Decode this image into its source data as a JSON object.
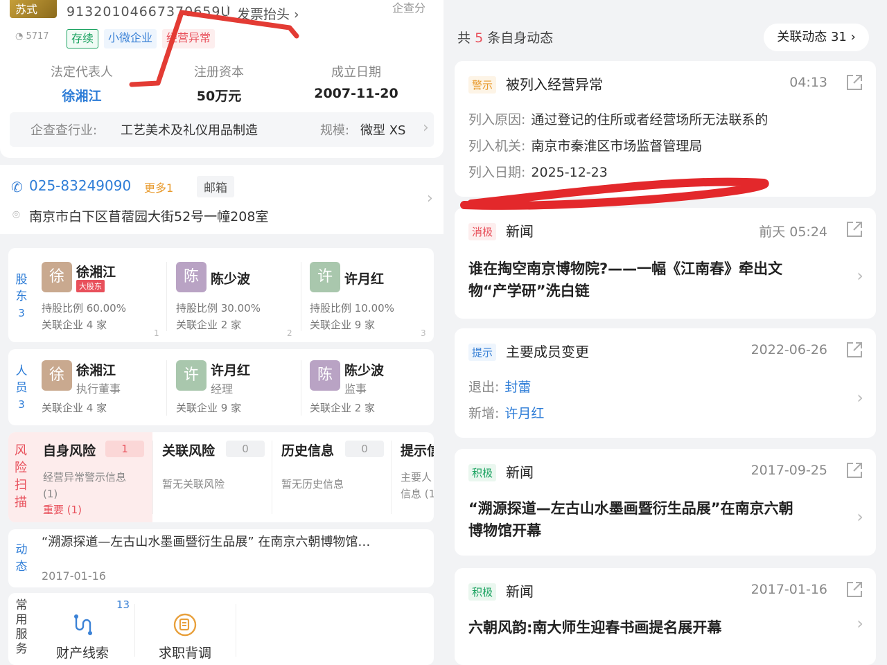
{
  "left": {
    "header": {
      "logo_text": "苏式",
      "credit_code": "91320104667370659U",
      "invoice_label": "发票抬头",
      "qcc_score": "企查分",
      "views": "5717"
    },
    "tags": [
      "存续",
      "小微企业",
      "经营异常"
    ],
    "info": [
      {
        "label": "法定代表人",
        "value": "徐湘江"
      },
      {
        "label": "注册资本",
        "value": "50万元"
      },
      {
        "label": "成立日期",
        "value": "2007-11-20"
      }
    ],
    "industry": {
      "label": "企查查行业:",
      "value": "工艺美术及礼仪用品制造",
      "scale_label": "规模:",
      "scale_value": "微型 XS"
    },
    "contact": {
      "phone": "025-83249090",
      "more": "更多1",
      "mail": "邮箱",
      "address": "南京市白下区苜蓿园大街52号一幢208室"
    },
    "shareholders": {
      "label": "股东",
      "count": "3",
      "items": [
        {
          "initial": "徐",
          "name": "徐湘江",
          "badge": "大股东",
          "ratio": "持股比例 60.00%",
          "related": "关联企业 4 家",
          "index": "1"
        },
        {
          "initial": "陈",
          "name": "陈少波",
          "ratio": "持股比例 30.00%",
          "related": "关联企业 2 家",
          "index": "2"
        },
        {
          "initial": "许",
          "name": "许月红",
          "ratio": "持股比例 10.00%",
          "related": "关联企业 9 家",
          "index": "3"
        }
      ]
    },
    "staff": {
      "label": "人员",
      "count": "3",
      "items": [
        {
          "initial": "徐",
          "name": "徐湘江",
          "role": "执行董事",
          "related": "关联企业 4 家"
        },
        {
          "initial": "许",
          "name": "许月红",
          "role": "经理",
          "related": "关联企业 9 家"
        },
        {
          "initial": "陈",
          "name": "陈少波",
          "role": "监事",
          "related": "关联企业 2 家"
        }
      ]
    },
    "risk": {
      "label": "风险扫描",
      "self": {
        "title": "自身风险",
        "count": "1",
        "sub1": "经营异常警示信息",
        "sub2": "(1)",
        "important": "重要 (1)"
      },
      "related": {
        "title": "关联风险",
        "count": "0",
        "sub": "暂无关联风险"
      },
      "history": {
        "title": "历史信息",
        "count": "0",
        "sub": "暂无历史信息"
      },
      "tips": {
        "title": "提示信",
        "sub1": "主要人",
        "sub2": "信息 (1"
      }
    },
    "dynamic": {
      "label": "动态",
      "text": "“溯源探道—左古山水墨画暨衍生品展” 在南京六朝博物馆…",
      "date": "2017-01-16"
    },
    "services": {
      "label": "常用服务",
      "items": [
        {
          "label": "财产线索",
          "count": "13"
        },
        {
          "label": "求职背调"
        }
      ]
    }
  },
  "right": {
    "summary_prefix": "共",
    "summary_count": "5",
    "summary_suffix": "条自身动态",
    "related_btn": "关联动态 31",
    "events": [
      {
        "tag": "警示",
        "title": "被列入经营异常",
        "time": "04:13",
        "lines": [
          {
            "k": "列入原因:",
            "v": "通过登记的住所或者经营场所无法联系的"
          },
          {
            "k": "列入机关:",
            "v": "南京市秦淮区市场监督管理局"
          },
          {
            "k": "列入日期:",
            "v": "2025-12-23"
          }
        ]
      },
      {
        "tag": "消极",
        "title": "新闻",
        "time": "前天 05:24",
        "news1": "谁在掏空南京博物院?——一幅《江南春》牵出文",
        "news2": "物“产学研”洗白链"
      },
      {
        "tag": "提示",
        "title": "主要成员变更",
        "time": "2022-06-26",
        "lines": [
          {
            "k": "退出:",
            "v": "封蕾"
          },
          {
            "k": "新增:",
            "v": "许月红"
          }
        ]
      },
      {
        "tag": "积极",
        "title": "新闻",
        "time": "2017-09-25",
        "news1": "“溯源探道—左古山水墨画暨衍生品展”在南京六朝",
        "news2": "博物馆开幕"
      },
      {
        "tag": "积极",
        "title": "新闻",
        "time": "2017-01-16",
        "news1": "六朝风韵:南大师生迎春书画提名展开幕"
      }
    ]
  },
  "colors": {
    "accent": "#2e7dd7",
    "danger": "#e8505b",
    "success": "#1aa260",
    "warn": "#e89a2c"
  }
}
